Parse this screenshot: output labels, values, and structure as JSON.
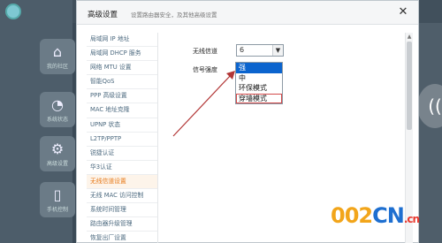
{
  "background": {
    "tiles": [
      {
        "label": "我的社区",
        "icon": "home-icon"
      },
      {
        "label": "系统状态",
        "icon": "status-icon"
      },
      {
        "label": "高级设置",
        "icon": "gear-icon"
      },
      {
        "label": "手机控制",
        "icon": "phone-icon"
      }
    ]
  },
  "modal": {
    "title": "高级设置",
    "subtitle": "设置路由器安全，及其他高级设置",
    "close_label": "✕"
  },
  "sidebar": {
    "items": [
      {
        "label": "局域网 IP 地址"
      },
      {
        "label": "局域网 DHCP 服务"
      },
      {
        "label": "网络 MTU 设置"
      },
      {
        "label": "智能QoS"
      },
      {
        "label": "PPP 高级设置"
      },
      {
        "label": "MAC 地址克隆"
      },
      {
        "label": "UPNP 状态"
      },
      {
        "label": "L2TP/PPTP"
      },
      {
        "label": "锐捷认证"
      },
      {
        "label": "华3认证"
      },
      {
        "label": "无线信道设置"
      },
      {
        "label": "无线 MAC 访问控制"
      },
      {
        "label": "系统时间管理"
      },
      {
        "label": "路由器升级管理"
      },
      {
        "label": "恢复出厂设置"
      }
    ],
    "active_index": 10
  },
  "form": {
    "channel_label": "无线信道",
    "channel_value": "6",
    "strength_label": "信号强度",
    "strength_options": [
      "强",
      "中",
      "环保模式",
      "穿墙模式"
    ],
    "strength_selected": "强",
    "strength_highlight": "穿墙模式"
  },
  "watermark": {
    "part1": "002",
    "part2": "CN",
    "part3": ".cn"
  },
  "colors": {
    "accent_active": "#e67817",
    "selection_blue": "#0b64ce",
    "annotation_red": "#d24a4a"
  }
}
